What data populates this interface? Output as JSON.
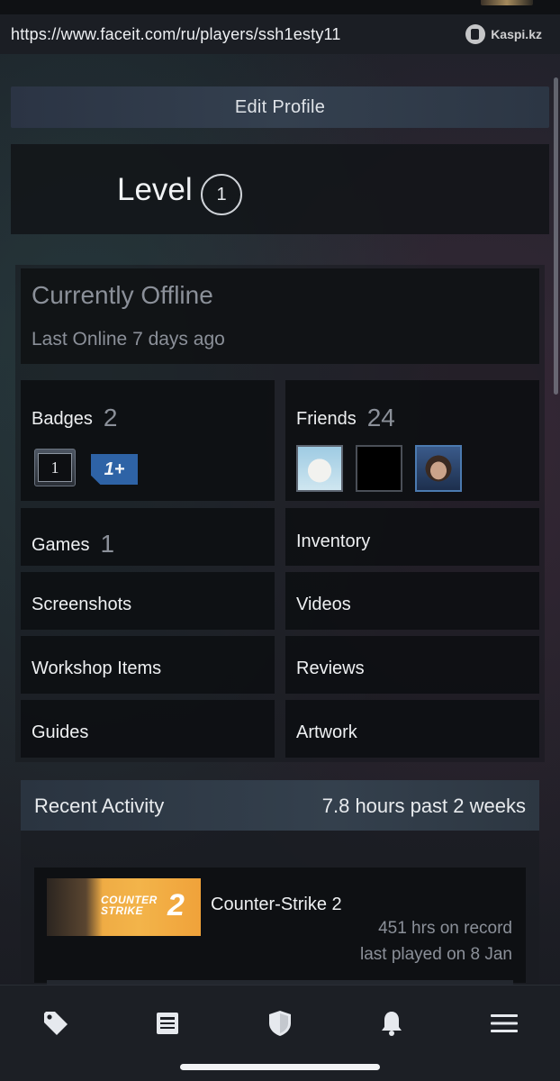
{
  "browser": {
    "url": "https://www.faceit.com/ru/players/ssh1esty11",
    "watermark": "Kaspi.kz"
  },
  "profile": {
    "edit_label": "Edit Profile",
    "level_label": "Level",
    "level_value": "1"
  },
  "status": {
    "main": "Currently Offline",
    "sub": "Last Online 7 days ago"
  },
  "stats": {
    "badges_label": "Badges",
    "badges_count": "2",
    "badge_tiles": [
      "1",
      "1+"
    ],
    "friends_label": "Friends",
    "friends_count": "24",
    "games_label": "Games",
    "games_count": "1",
    "inventory_label": "Inventory",
    "screenshots_label": "Screenshots",
    "videos_label": "Videos",
    "workshop_label": "Workshop Items",
    "reviews_label": "Reviews",
    "guides_label": "Guides",
    "artwork_label": "Artwork"
  },
  "activity": {
    "title": "Recent Activity",
    "summary": "7.8 hours past 2 weeks",
    "game": {
      "name": "Counter-Strike 2",
      "hours": "451 hrs on record",
      "last_played": "last played on 8 Jan",
      "logo_line1": "COUNTER",
      "logo_line2": "STRIKE",
      "logo_num": "2"
    }
  },
  "nav": {
    "items": [
      "tag-icon",
      "news-icon",
      "shield-icon",
      "bell-icon",
      "menu-icon"
    ]
  },
  "colors": {
    "muted_text": "#8b9099",
    "badge_blue": "#2e63a6",
    "cs2_orange": "#f0a23a"
  }
}
